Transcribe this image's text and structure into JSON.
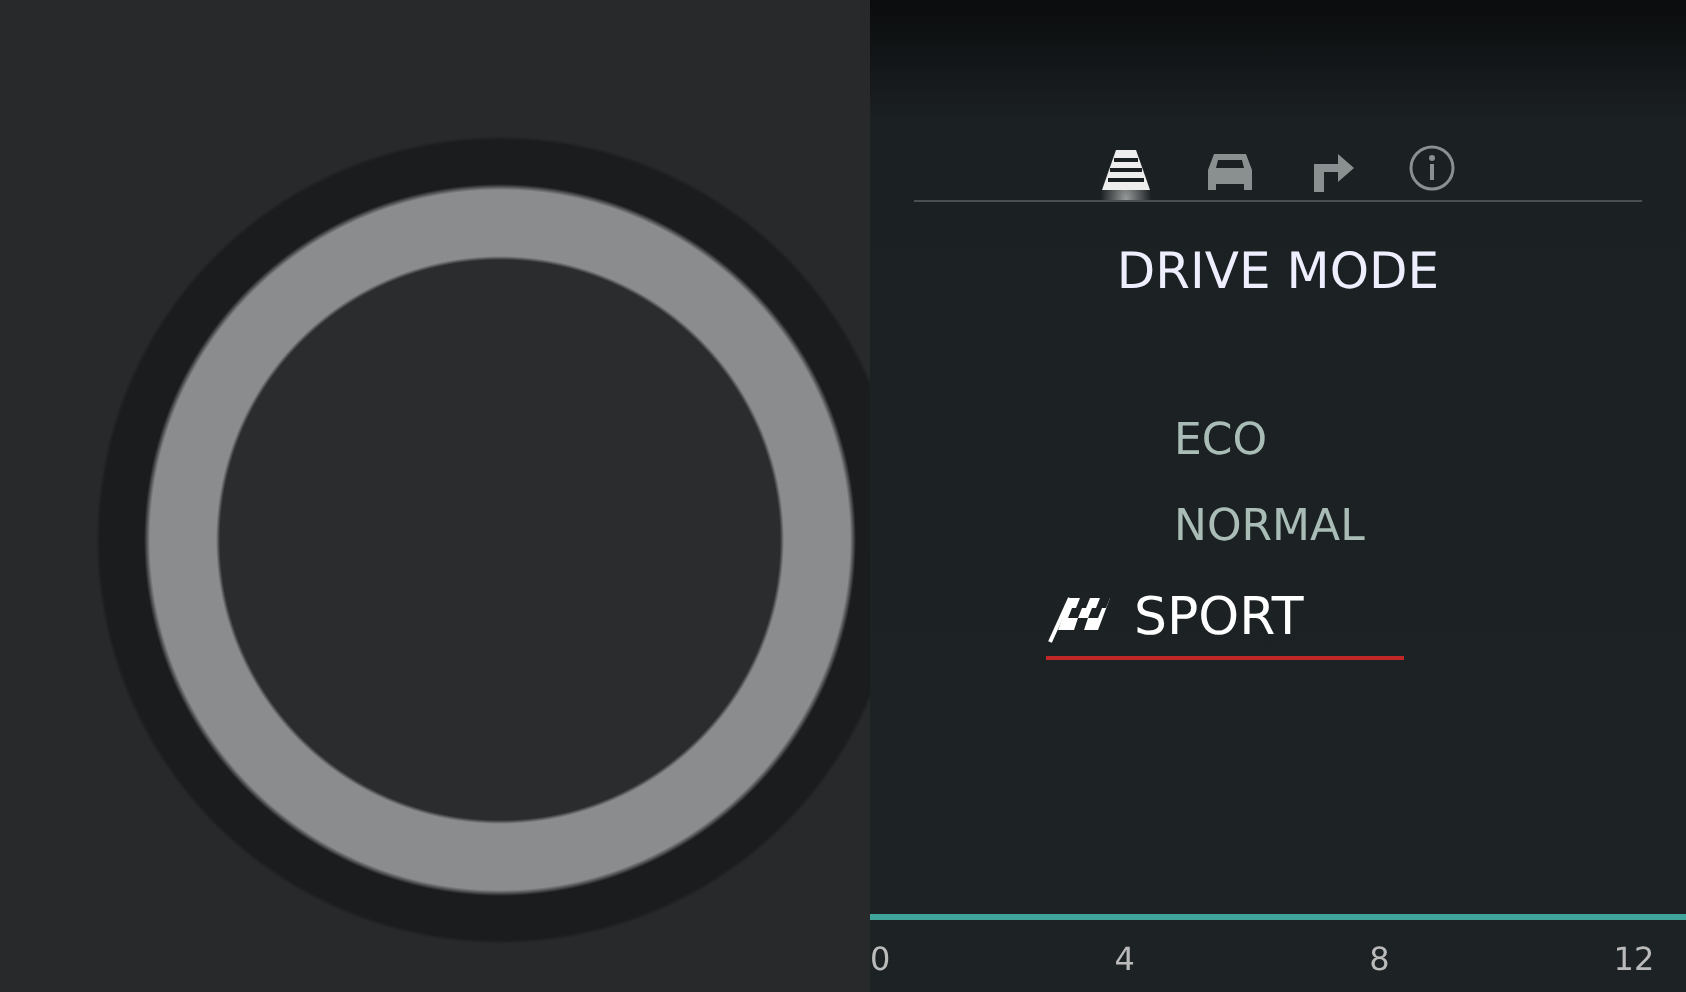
{
  "display": {
    "tabs": [
      {
        "kind": "road",
        "selected": true
      },
      {
        "kind": "car",
        "selected": false
      },
      {
        "kind": "turn",
        "selected": false
      },
      {
        "kind": "info",
        "selected": false
      }
    ],
    "title": "DRIVE MODE",
    "modes": [
      {
        "label": "ECO",
        "selected": false
      },
      {
        "label": "NORMAL",
        "selected": false
      },
      {
        "label": "SPORT",
        "selected": true
      }
    ],
    "scale": [
      "0",
      "4",
      "8",
      "12"
    ]
  }
}
